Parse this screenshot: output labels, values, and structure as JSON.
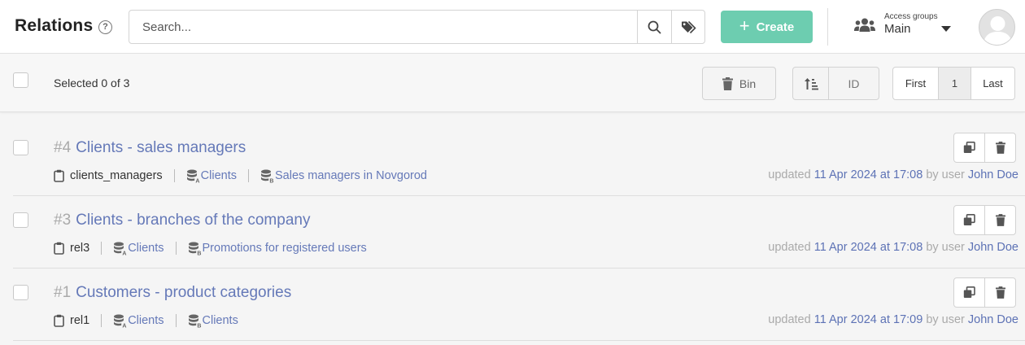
{
  "header": {
    "title": "Relations",
    "help_icon": "?",
    "search_placeholder": "Search...",
    "create_label": "Create",
    "access_groups_label": "Access groups",
    "access_group_value": "Main"
  },
  "toolbar": {
    "selected_text": "Selected 0 of 3",
    "bin_label": "Bin",
    "sort_label": "ID",
    "pager": {
      "first": "First",
      "current": "1",
      "last": "Last"
    }
  },
  "rows": [
    {
      "id": "#4",
      "name": "Clients - sales managers",
      "code": "clients_managers",
      "source_a": "Clients",
      "source_b": "Sales managers in Novgorod",
      "updated_prefix": "updated",
      "updated_at": "11 Apr 2024 at 17:08",
      "by_text": "by user",
      "user": "John Doe"
    },
    {
      "id": "#3",
      "name": "Clients - branches of the company",
      "code": "rel3",
      "source_a": "Clients",
      "source_b": "Promotions for registered users",
      "updated_prefix": "updated",
      "updated_at": "11 Apr 2024 at 17:08",
      "by_text": "by user",
      "user": "John Doe"
    },
    {
      "id": "#1",
      "name": "Customers - product categories",
      "code": "rel1",
      "source_a": "Clients",
      "source_b": "Clients",
      "updated_prefix": "updated",
      "updated_at": "11 Apr 2024 at 17:09",
      "by_text": "by user",
      "user": "John Doe"
    }
  ],
  "colors": {
    "accent_create": "#6dcdb0",
    "link": "#6579b8"
  },
  "icons": [
    "help-icon",
    "search-icon",
    "tags-icon",
    "plus-icon",
    "users-icon",
    "caret-down-icon",
    "avatar",
    "trash-icon",
    "sort-ascending-icon",
    "clipboard-icon",
    "database-a-icon",
    "database-b-icon",
    "copy-icon"
  ]
}
